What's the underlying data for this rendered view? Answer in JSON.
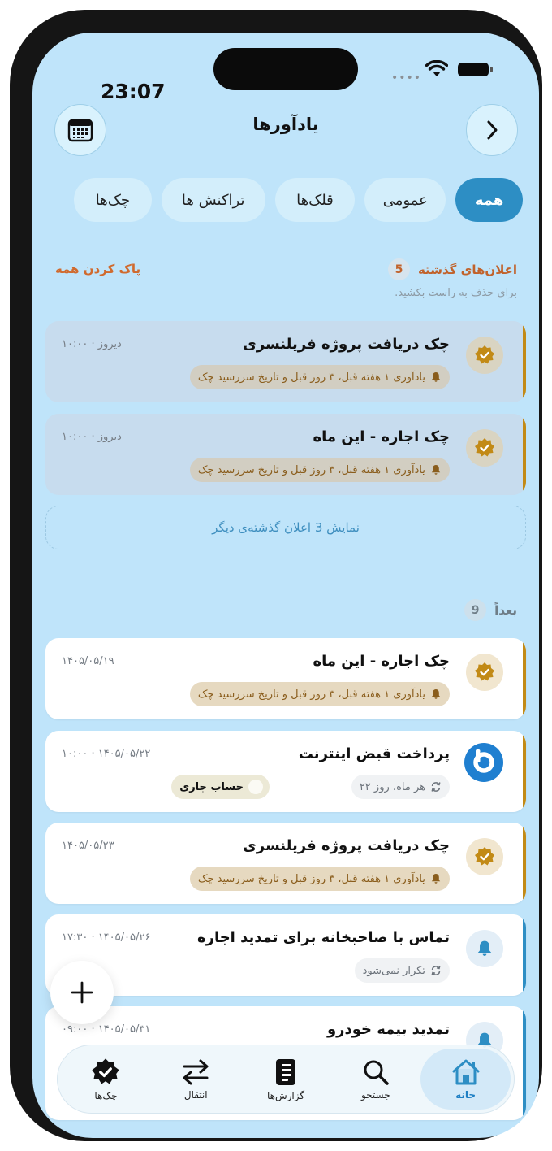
{
  "status_bar": {
    "time": "23:07",
    "signal": "••••"
  },
  "header": {
    "title": "یادآورها",
    "back_icon": "chevron-right-icon",
    "calendar_icon": "calendar-icon"
  },
  "tabs": [
    {
      "label": "همه",
      "active": true
    },
    {
      "label": "عمومی",
      "active": false
    },
    {
      "label": "قلک‌ها",
      "active": false
    },
    {
      "label": "تراکنش ها",
      "active": false
    },
    {
      "label": "چک‌ها",
      "active": false
    }
  ],
  "past": {
    "title": "اعلان‌های گذشته",
    "count": "5",
    "hint": "برای حذف به راست بکشید.",
    "clear_all": "پاک کردن همه",
    "items": [
      {
        "title": "چک دریافت پروژه فریلنسری",
        "date": "دیروز · ۱۰:۰۰",
        "reminder": "یادآوری ۱ هفته قبل، ۳ روز قبل و تاریخ سررسید چک"
      },
      {
        "title": "چک اجاره - این ماه",
        "date": "دیروز · ۱۰:۰۰",
        "reminder": "یادآوری ۱ هفته قبل، ۳ روز قبل و تاریخ سررسید چک"
      }
    ],
    "show_more": "نمایش 3 اعلان گذشته‌ی دیگر"
  },
  "upcoming": {
    "title": "بعداً",
    "count": "9",
    "items": [
      {
        "title": "چک اجاره - این ماه",
        "date": "۱۴۰۵/۰۵/۱۹",
        "reminder": "یادآوری ۱ هفته قبل، ۳ روز قبل و تاریخ سررسید چک"
      },
      {
        "title": "پرداخت قبض اینترنت",
        "date": "۱۴۰۵/۰۵/۲۲ · ۱۰:۰۰",
        "repeat": "هر ماه، روز ۲۲",
        "account": "حساب جاری"
      },
      {
        "title": "چک دریافت پروژه فریلنسری",
        "date": "۱۴۰۵/۰۵/۲۳",
        "reminder": "یادآوری ۱ هفته قبل، ۳ روز قبل و تاریخ سررسید چک"
      },
      {
        "title": "تماس با صاحبخانه برای تمدید اجاره",
        "date": "۱۴۰۵/۰۵/۲۶ · ۱۷:۳۰",
        "repeat": "تکرار نمی‌شود"
      },
      {
        "title": "تمدید بیمه خودرو",
        "date": "۱۴۰۵/۰۵/۳۱ · ۰۹:۰۰"
      }
    ]
  },
  "colors": {
    "background": "#bfe4fa",
    "accent_blue": "#2d8ec4",
    "check_accent": "#c28a16",
    "orange": "#d06a2e"
  },
  "bottom_nav": [
    {
      "label": "خانه",
      "icon": "home-icon",
      "active": true
    },
    {
      "label": "جستجو",
      "icon": "search-icon",
      "active": false
    },
    {
      "label": "گزارش‌ها",
      "icon": "report-icon",
      "active": false
    },
    {
      "label": "انتقال",
      "icon": "transfer-icon",
      "active": false
    },
    {
      "label": "چک‌ها",
      "icon": "check-badge-icon",
      "active": false
    }
  ]
}
